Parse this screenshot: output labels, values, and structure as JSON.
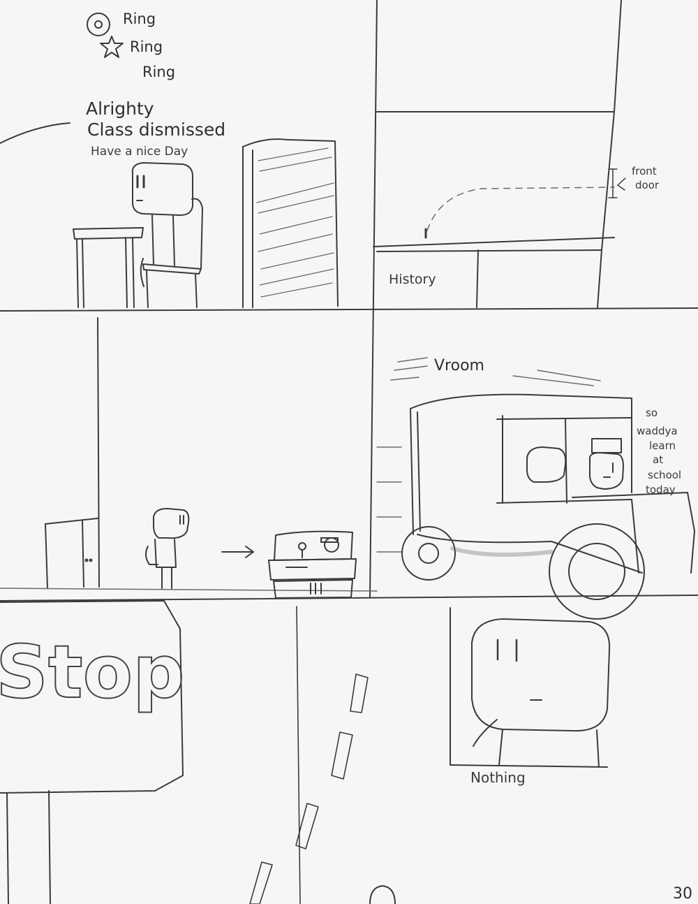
{
  "panel1": {
    "sfx_lines": [
      "Ring",
      "Ring",
      "Ring"
    ],
    "speech_line1": "Alrighty",
    "speech_line2": "Class dismissed",
    "speech_line3": "Have a nice Day"
  },
  "panel2": {
    "label_front_door_1": "front",
    "label_front_door_2": "door",
    "label_history": "History"
  },
  "panel4": {
    "sfx": "Vroom",
    "speech_lines": [
      "so",
      "waddya",
      "learn",
      "at",
      "school",
      "today"
    ]
  },
  "panel5": {
    "sign_text": "Stop"
  },
  "panel6": {
    "reply": "Nothing"
  },
  "page_number": "30"
}
